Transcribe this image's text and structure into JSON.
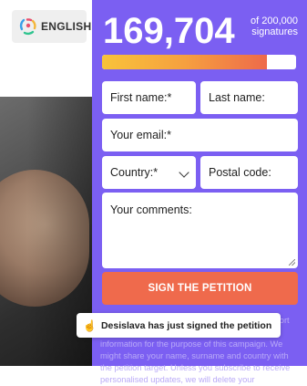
{
  "language_selector": {
    "label": "ENGLISH",
    "icon": "globe-icon"
  },
  "petition": {
    "signature_count": "169,704",
    "goal_line1": "of 200,000",
    "goal_line2": "signatures",
    "progress_fraction": 0.8485,
    "colors": {
      "panel": "#7b5ff2",
      "button": "#ef6a4c",
      "progress_start": "#f8c33a",
      "progress_end": "#ee6a4a"
    }
  },
  "form": {
    "first_name_placeholder": "First name:*",
    "last_name_placeholder": "Last name:",
    "email_placeholder": "Your email:*",
    "country_placeholder": "Country:*",
    "postal_code_placeholder": "Postal code:",
    "comments_placeholder": "Your comments:",
    "submit_label": "SIGN THE PETITION"
  },
  "disclaimer": {
    "text": "By clicking \"Sign the petition\" you agree to support this campaign, and you agree to us using your information for the purpose of this campaign. We might share your name, surname and country with the petition target. Unless you subscribe to receive personalised updates, we will delete your"
  },
  "notification": {
    "text": "Desislava has just signed the petition",
    "icon": "pointing-hand-icon"
  }
}
